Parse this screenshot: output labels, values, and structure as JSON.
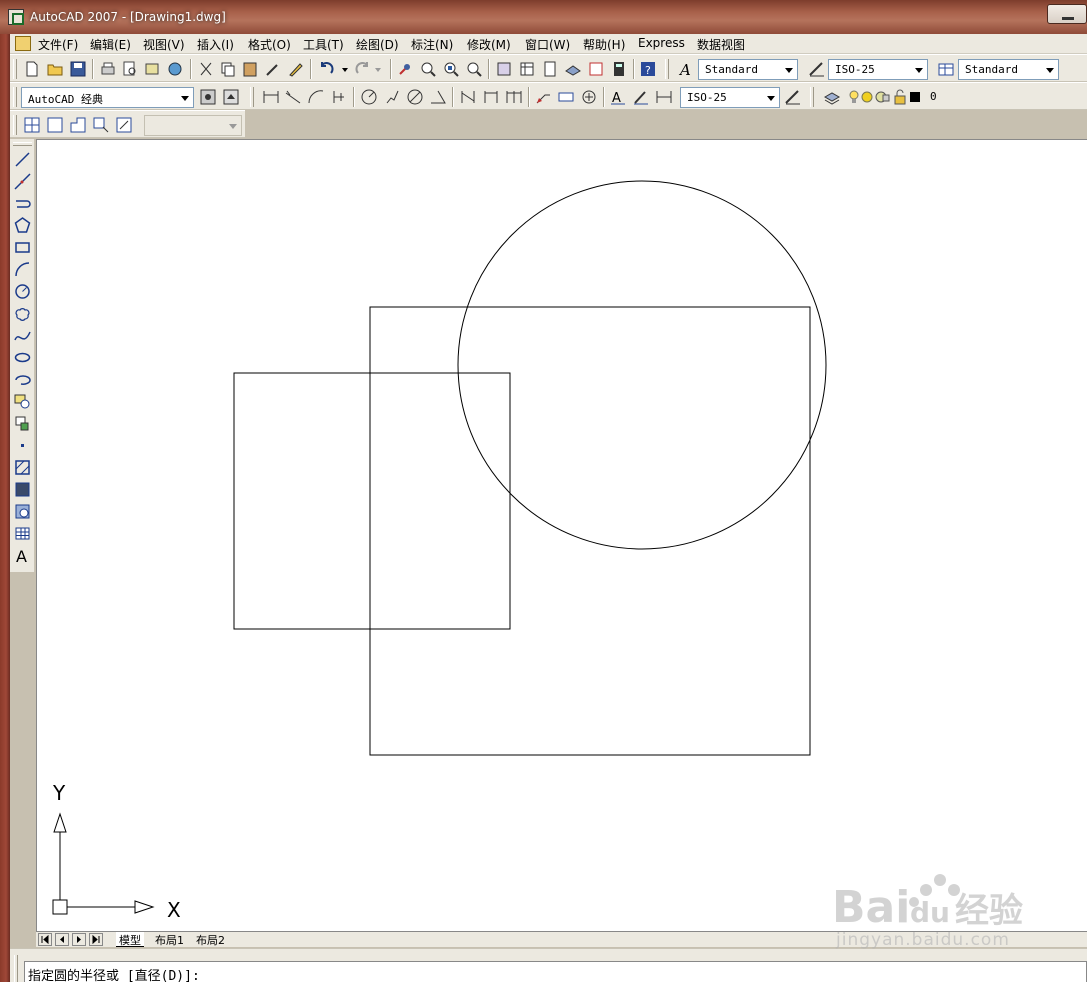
{
  "window": {
    "title": "AutoCAD 2007 - [Drawing1.dwg]"
  },
  "menu": [
    {
      "label": "文件(F)"
    },
    {
      "label": "编辑(E)"
    },
    {
      "label": "视图(V)"
    },
    {
      "label": "插入(I)"
    },
    {
      "label": "格式(O)"
    },
    {
      "label": "工具(T)"
    },
    {
      "label": "绘图(D)"
    },
    {
      "label": "标注(N)"
    },
    {
      "label": "修改(M)"
    },
    {
      "label": "窗口(W)"
    },
    {
      "label": "帮助(H)"
    },
    {
      "label": "Express"
    },
    {
      "label": "数据视图"
    }
  ],
  "styles": {
    "text_style": "Standard",
    "dim_style": "ISO-25",
    "table_style": "Standard",
    "workspace": "AutoCAD 经典",
    "dim_style_2": "ISO-25",
    "layer": "0",
    "view_combo": ""
  },
  "drawing": {
    "axis_y_label": "Y",
    "axis_x_label": "X"
  },
  "tabs": [
    {
      "label": "模型",
      "active": true
    },
    {
      "label": "布局1",
      "active": false
    },
    {
      "label": "布局2",
      "active": false
    }
  ],
  "command_line": {
    "prompt": "指定圆的半径或 [直径(D)]:"
  },
  "watermark": {
    "sub": "jingyan.baidu.com"
  },
  "colors": {
    "title_bar": "#a8604a",
    "toolbar_bg": "#ece9e0",
    "canvas_bg": "#ffffff",
    "geometry": "#000000"
  }
}
